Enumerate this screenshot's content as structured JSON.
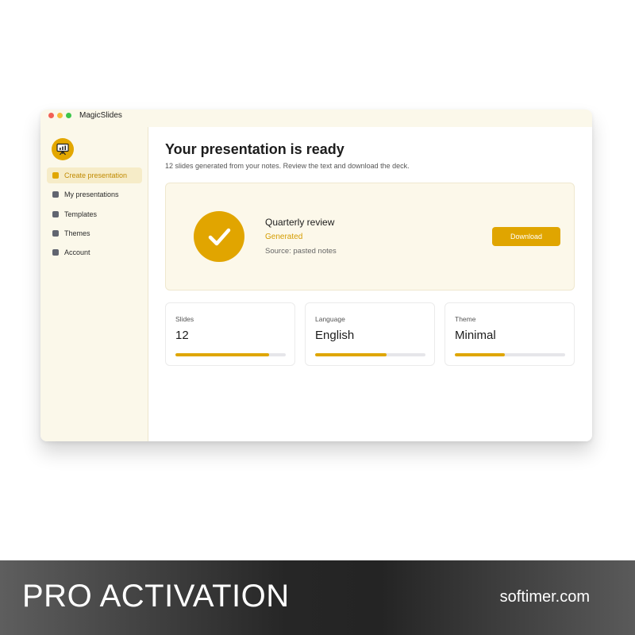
{
  "app": {
    "title": "MagicSlides",
    "logo_icon": "presentation-board-icon",
    "accent_color": "#e0a600",
    "sidebar_bg": "#fbf8ea"
  },
  "sidebar": {
    "items": [
      {
        "label": "Create presentation",
        "active": true
      },
      {
        "label": "My presentations",
        "active": false
      },
      {
        "label": "Templates",
        "active": false
      },
      {
        "label": "Themes",
        "active": false
      },
      {
        "label": "Account",
        "active": false
      }
    ]
  },
  "main": {
    "title": "Your presentation is ready",
    "subtitle": "12 slides generated from your notes. Review the text and download the deck.",
    "result": {
      "icon": "checkmark-icon",
      "name": "Quarterly review",
      "status": "Generated",
      "source": "Source: pasted notes",
      "download_label": "Download"
    },
    "stats": [
      {
        "label": "Slides",
        "value": "12",
        "progress": 0.85
      },
      {
        "label": "Language",
        "value": "English",
        "progress": 0.65
      },
      {
        "label": "Theme",
        "value": "Minimal",
        "progress": 0.45
      }
    ]
  },
  "banner": {
    "title": "PRO ACTIVATION",
    "site": "softimer.com"
  }
}
